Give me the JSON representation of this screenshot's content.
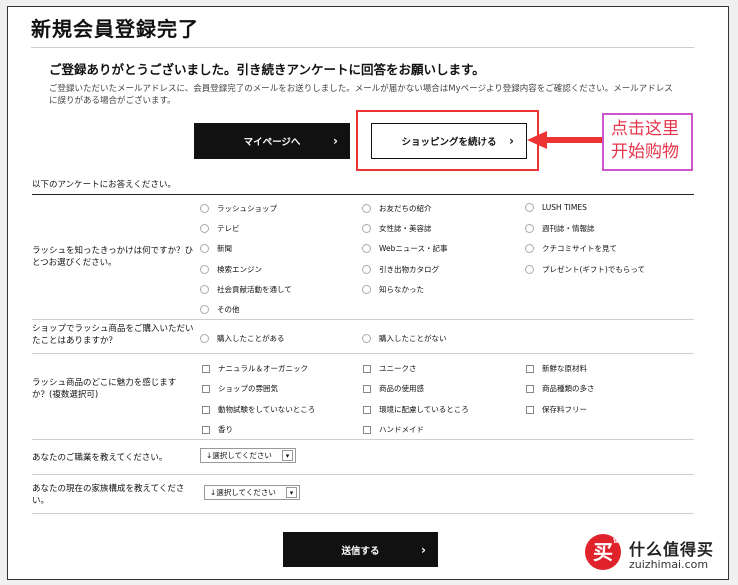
{
  "page": {
    "title": "新規会員登録完了",
    "subtitle": "ご登録ありがとうございました。引き続きアンケートに回答をお願いします。",
    "note": "ご登録いただいたメールアドレスに、会員登録完了のメールをお送りしました。メールが届かない場合はMyページより登録内容をご確認ください。メールアドレスに誤りがある場合がございます。"
  },
  "buttons": {
    "mypage": "マイページへ",
    "shopping": "ショッピングを続ける",
    "submit": "送信する",
    "chevron": "›"
  },
  "annotation": {
    "line1": "点击这里",
    "line2": "开始购物"
  },
  "survey": {
    "intro": "以下のアンケートにお答えください。",
    "q1": {
      "label": "ラッシュを知ったきっかけは何ですか？ひとつお選びください。",
      "options": [
        "ラッシュショップ",
        "お友だちの紹介",
        "LUSH TIMES",
        "テレビ",
        "女性誌・美容誌",
        "週刊誌・情報誌",
        "新聞",
        "Webニュース・記事",
        "クチコミサイトを見て",
        "検索エンジン",
        "引き出物カタログ",
        "プレゼント(ギフト)でもらって",
        "社会貢献活動を通して",
        "知らなかった",
        "その他"
      ]
    },
    "q2": {
      "label": "ショップでラッシュ商品をご購入いただいたことはありますか？",
      "options": [
        "購入したことがある",
        "購入したことがない"
      ]
    },
    "q3": {
      "label": "ラッシュ商品のどこに魅力を感じますか？(複数選択可)",
      "options": [
        "ナニュラル＆オーガニック",
        "ユニークさ",
        "新鮮な原材料",
        "ショップの雰囲気",
        "商品の使用感",
        "商品種類の多さ",
        "動物試験をしていないところ",
        "環境に配慮しているところ",
        "保存料フリー",
        "香り",
        "ハンドメイド"
      ]
    },
    "q4": {
      "label": "あなたのご職業を教えてください。",
      "select": "↓選択してください"
    },
    "q5": {
      "label": "あなたの現在の家族構成を教えてください。",
      "select": "↓選択してください"
    }
  },
  "watermark": {
    "logo": "买",
    "logo_sup": "值",
    "name": "什么值得买",
    "url": "zuizhimai.com"
  },
  "colors": {
    "highlight": "#e33333",
    "annotation_border": "#cc55cc",
    "annotation_text": "#e5354a",
    "button_dark": "#111111"
  }
}
